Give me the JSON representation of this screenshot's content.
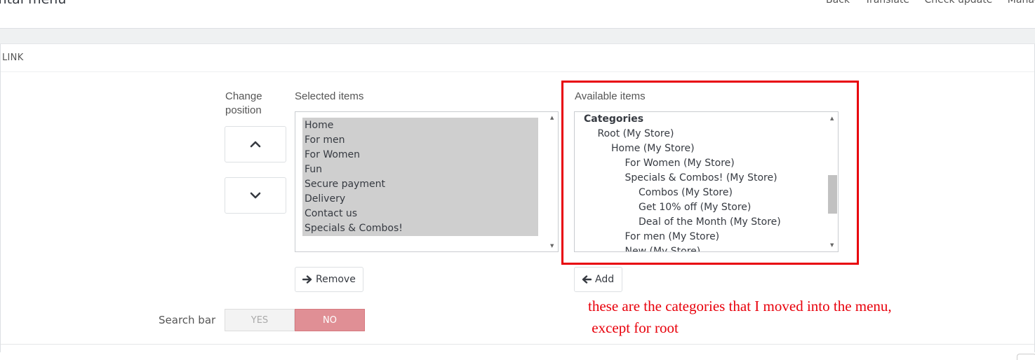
{
  "header": {
    "title": "ontal menu",
    "toolbar": [
      "Back",
      "Translate",
      "Check update",
      "Manag"
    ]
  },
  "panel": {
    "heading": "LINK"
  },
  "position": {
    "label_line1": "Change",
    "label_line2": "position",
    "up_icon": "chevron-up-icon",
    "down_icon": "chevron-down-icon"
  },
  "selected": {
    "label": "Selected items",
    "items": [
      "Home",
      "For men",
      "For Women",
      "Fun",
      "Secure payment",
      "Delivery",
      "Contact us",
      "Specials & Combos!"
    ],
    "remove_label": "Remove"
  },
  "available": {
    "label": "Available items",
    "items": [
      {
        "text": "Categories",
        "level": 0
      },
      {
        "text": "Root (My Store)",
        "level": 1
      },
      {
        "text": "Home (My Store)",
        "level": 2
      },
      {
        "text": "For Women (My Store)",
        "level": 3
      },
      {
        "text": "Specials & Combos! (My Store)",
        "level": 3
      },
      {
        "text": "Combos (My Store)",
        "level": 4
      },
      {
        "text": "Get 10% off (My Store)",
        "level": 4
      },
      {
        "text": "Deal of the Month (My Store)",
        "level": 4
      },
      {
        "text": "For men (My Store)",
        "level": 3
      },
      {
        "text": "New (My Store)",
        "level": 3
      }
    ],
    "add_label": "Add"
  },
  "search_bar": {
    "label": "Search bar",
    "yes": "YES",
    "no": "NO"
  },
  "annotation": {
    "line1": "these are the categories that I moved into the menu,",
    "line2": " except for root",
    "color": "#e8000b"
  }
}
